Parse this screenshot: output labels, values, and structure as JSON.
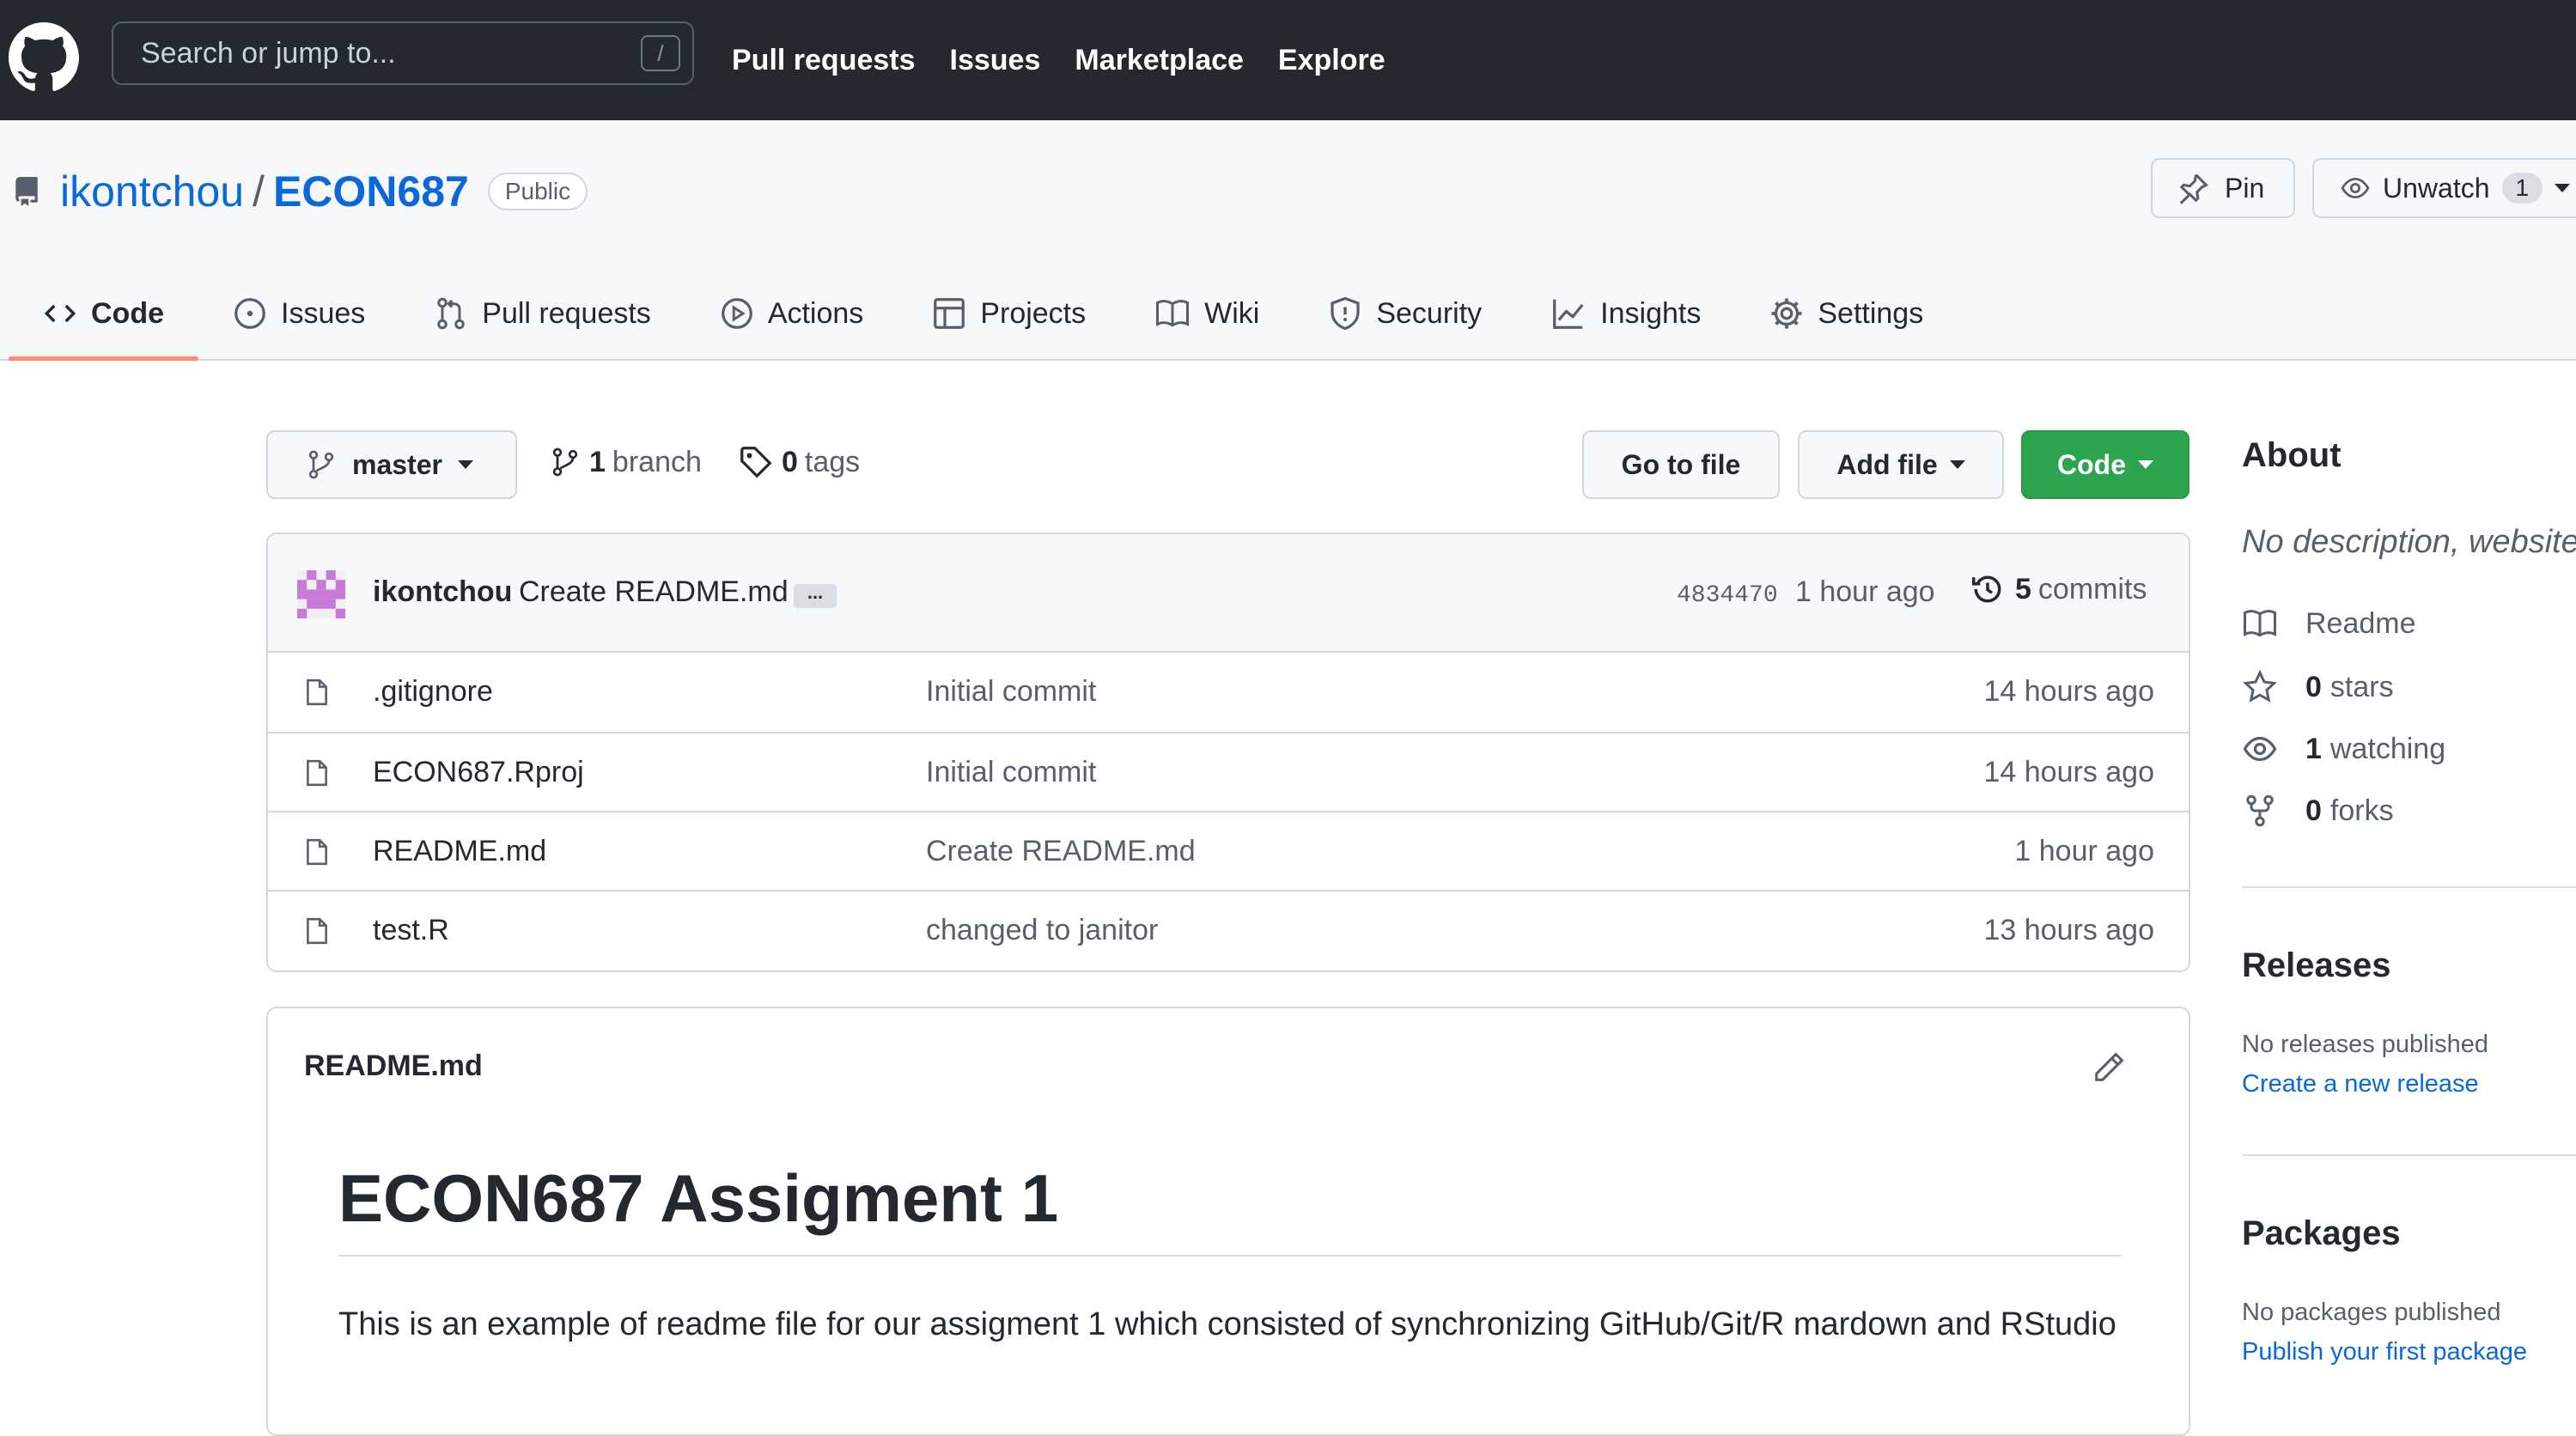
{
  "header": {
    "search_placeholder": "Search or jump to...",
    "search_shortcut": "/",
    "nav": [
      "Pull requests",
      "Issues",
      "Marketplace",
      "Explore"
    ]
  },
  "repo": {
    "owner": "ikontchou",
    "separator": "/",
    "name": "ECON687",
    "visibility": "Public",
    "pin_label": "Pin",
    "watch_label": "Unwatch",
    "watch_count": "1"
  },
  "tabs": [
    {
      "label": "Code",
      "icon": "code-icon",
      "active": true
    },
    {
      "label": "Issues",
      "icon": "issue-icon"
    },
    {
      "label": "Pull requests",
      "icon": "pull-request-icon"
    },
    {
      "label": "Actions",
      "icon": "play-icon"
    },
    {
      "label": "Projects",
      "icon": "table-icon"
    },
    {
      "label": "Wiki",
      "icon": "book-icon"
    },
    {
      "label": "Security",
      "icon": "shield-icon"
    },
    {
      "label": "Insights",
      "icon": "graph-icon"
    },
    {
      "label": "Settings",
      "icon": "gear-icon"
    }
  ],
  "filenav": {
    "branch": "master",
    "branch_count": "1",
    "branch_word": "branch",
    "tag_count": "0",
    "tag_word": "tags",
    "go_to_file": "Go to file",
    "add_file": "Add file",
    "code": "Code"
  },
  "commit": {
    "author": "ikontchou",
    "message": "Create README.md",
    "ellipsis": "...",
    "sha": "4834470",
    "time": "1 hour ago",
    "count": "5",
    "count_word": "commits"
  },
  "files": [
    {
      "name": ".gitignore",
      "message": "Initial commit",
      "time": "14 hours ago"
    },
    {
      "name": "ECON687.Rproj",
      "message": "Initial commit",
      "time": "14 hours ago"
    },
    {
      "name": "README.md",
      "message": "Create README.md",
      "time": "1 hour ago"
    },
    {
      "name": "test.R",
      "message": "changed to janitor",
      "time": "13 hours ago"
    }
  ],
  "readme": {
    "filename": "README.md",
    "heading": "ECON687 Assigment 1",
    "paragraph": "This is an example of readme file for our assigment 1 which consisted of synchronizing GitHub/Git/R mardown and RStudio"
  },
  "about": {
    "title": "About",
    "description": "No description, website",
    "readme": "Readme",
    "stars_count": "0",
    "stars_word": "stars",
    "watching_count": "1",
    "watching_word": "watching",
    "forks_count": "0",
    "forks_word": "forks"
  },
  "releases": {
    "title": "Releases",
    "note": "No releases published",
    "link": "Create a new release"
  },
  "packages": {
    "title": "Packages",
    "note": "No packages published",
    "link": "Publish your first package"
  },
  "colors": {
    "header_bg": "#24292f",
    "link_blue": "#0969da",
    "green_button": "#2da44e",
    "active_tab_underline": "#fd8c73"
  }
}
